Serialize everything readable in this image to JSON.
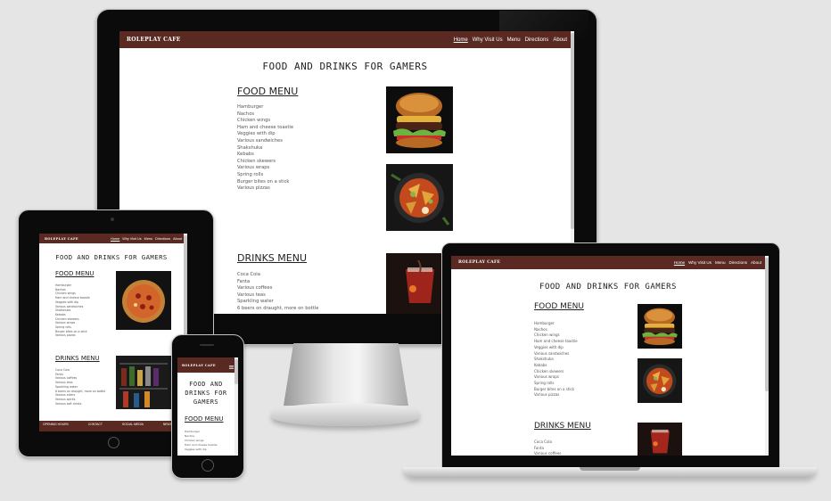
{
  "site": {
    "brand": "ROLEPLAY CAFE",
    "nav": [
      "Home",
      "Why Visit Us",
      "Menu",
      "Directions",
      "About"
    ],
    "title": "FOOD AND DRINKS FOR GAMERS",
    "title_mobile": [
      "FOOD AND",
      "DRINKS FOR",
      "GAMERS"
    ],
    "food_heading": "FOOD MENU",
    "food_items": [
      "Hamburger",
      "Nachos",
      "Chicken wings",
      "Ham and cheese toastie",
      "Veggies with dip",
      "Various sandwiches",
      "Shakshuka",
      "Kebabs",
      "Chicken skewers",
      "Various wraps",
      "Spring rolls",
      "Burger bites on a stick",
      "Various pizzas"
    ],
    "drinks_heading": "DRINKS MENU",
    "drinks_items": [
      "Coca Cola",
      "Fanta",
      "Various coffees",
      "Various teas",
      "Sparkling water",
      "6 beers on draught, more on bottle",
      "Various ciders",
      "Various spirits",
      "Various soft drinks"
    ],
    "footer": [
      "OPENING HOURS",
      "CONTACT",
      "SOCIAL MEDIA",
      "NEWSLETTER"
    ],
    "menu_icon": "hamburger-menu-icon"
  },
  "colors": {
    "navbar": "#5a2a22",
    "background": "#e5e5e5"
  }
}
